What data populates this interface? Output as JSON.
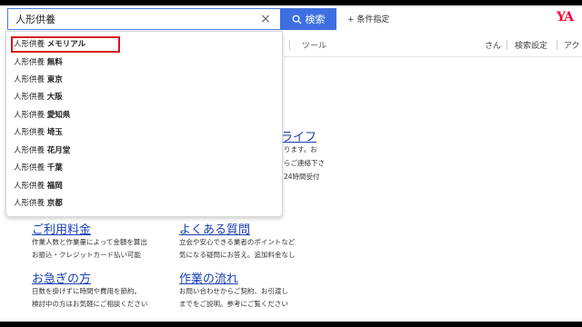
{
  "search": {
    "value": "人形供養",
    "clear_glyph": "×",
    "button_label": "検索",
    "condition_label": "+ 条件指定"
  },
  "logo": {
    "text": "YA"
  },
  "nav": {
    "tools": "ツール",
    "right": [
      "さん",
      "検索設定",
      "アク"
    ]
  },
  "suggestions": [
    {
      "prefix": "人形供養",
      "term": "メモリアル"
    },
    {
      "prefix": "人形供養",
      "term": "無料"
    },
    {
      "prefix": "人形供養",
      "term": "東京"
    },
    {
      "prefix": "人形供養",
      "term": "大阪"
    },
    {
      "prefix": "人形供養",
      "term": "愛知県"
    },
    {
      "prefix": "人形供養",
      "term": "埼玉"
    },
    {
      "prefix": "人形供養",
      "term": "花月堂"
    },
    {
      "prefix": "人形供養",
      "term": "千葉"
    },
    {
      "prefix": "人形供養",
      "term": "福岡"
    },
    {
      "prefix": "人形供養",
      "term": "京都"
    }
  ],
  "behind": {
    "title_fragment": "ズライフ",
    "lines": [
      "ります。お",
      "らご連絡下さ",
      "24時間受付"
    ]
  },
  "cards": [
    {
      "title": "ご利用料金",
      "lines": [
        "作業人数と作業量によって金額を算出",
        "お振込・クレジットカード払い可能"
      ]
    },
    {
      "title": "よくある質問",
      "lines": [
        "立会や安心できる業者のポイントなど",
        "気になる疑問にお答え。追加料金なし"
      ]
    },
    {
      "title": "お急ぎの方",
      "lines": [
        "日数を掛けずに時間や費用を節約。",
        "検討中の方はお気軽にご相談ください"
      ]
    },
    {
      "title": "作業の流れ",
      "lines": [
        "お問い合わせからご契約、お引渡し",
        "までをご説明。参考にご覧ください"
      ]
    }
  ],
  "colors": {
    "accent": "#3d6fe0",
    "link": "#1a3fb2",
    "highlight": "#d9101e",
    "logo": "#ff0033"
  },
  "icons": [
    "search-icon",
    "clear-icon"
  ]
}
